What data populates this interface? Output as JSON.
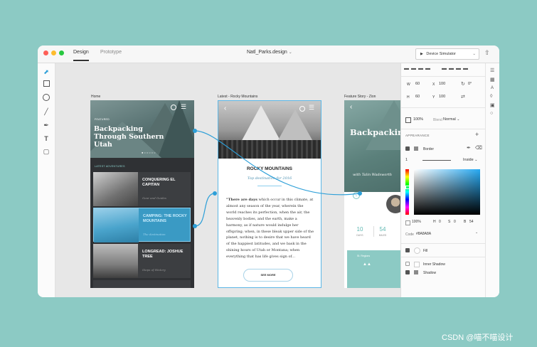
{
  "window": {
    "tabs": [
      {
        "label": "Design"
      },
      {
        "label": "Prototype"
      }
    ],
    "filename": "Natl_Parks.design",
    "device_button": "Device Simulator",
    "traffic_lights": [
      "#fe5f57",
      "#febc2e",
      "#28c840"
    ]
  },
  "tools": [
    "select-arrow",
    "rectangle",
    "ellipse",
    "line",
    "pen",
    "text",
    "artboard"
  ],
  "canvas": {
    "artboard_labels": [
      "Home",
      "Latest - Rocky Mountains",
      "Feature Story - Zion"
    ],
    "home": {
      "featured": "FEATURED",
      "title": "Backpacking Through Southern Utah",
      "section": "LATEST ADVENTURES",
      "items": [
        {
          "title": "CONQUERING EL CAPITAN",
          "subtitle": "Gear and Guides"
        },
        {
          "title": "CAMPING: THE ROCKY MOUNTAINS",
          "subtitle": "The destination"
        },
        {
          "title": "LONGREAD: JOSHUE TREE",
          "subtitle": "Steps of History"
        }
      ]
    },
    "article": {
      "title": "ROCKY MOUNTAINS",
      "subtitle": "Top destination for 2016",
      "lead": "\"There are days",
      "body": " which occur in this climate, at almost any season of the year, wherein the world reaches its perfection, when the air, the heavenly bodies, and the earth, make a harmony, as if nature would indulge her offspring; when, in these bleak upper side of the planet, nothing is to desire that we have heard of the happiest latitudes, and we bask in the shining hours of Utah or Montana; when everything that has life gives sign of...",
      "button": "SEE MORE"
    },
    "feature": {
      "title": "Backpacking Through Southern Utah",
      "byline": "with Talin Wadsworth",
      "stats": [
        {
          "value": "10",
          "label": "DAYS"
        },
        {
          "value": "54",
          "label": "MILES"
        }
      ],
      "map_label": "St. Regions"
    }
  },
  "inspector": {
    "W": "60",
    "X": "100",
    "rotation": "0°",
    "H": "60",
    "Y": "100",
    "opacity": "100%",
    "blend_label": "Blend",
    "blend_value": "Normal",
    "appearance": "APPEARANCE",
    "border_label": "Border",
    "border_width": "1",
    "border_position": "Inside",
    "color_alpha": "100%",
    "h_label": "H",
    "h_value": "0",
    "s_label": "S",
    "s_value": "0",
    "b_label": "B",
    "b_value": "54",
    "code_label": "Code",
    "code_value": "#8A8A8A",
    "fill_label": "Fill",
    "inner_shadow_label": "Inner Shadow",
    "shadow_label": "Shadow",
    "accent": "#27a9f2"
  },
  "watermark": "CSDN @喵不喵设计"
}
